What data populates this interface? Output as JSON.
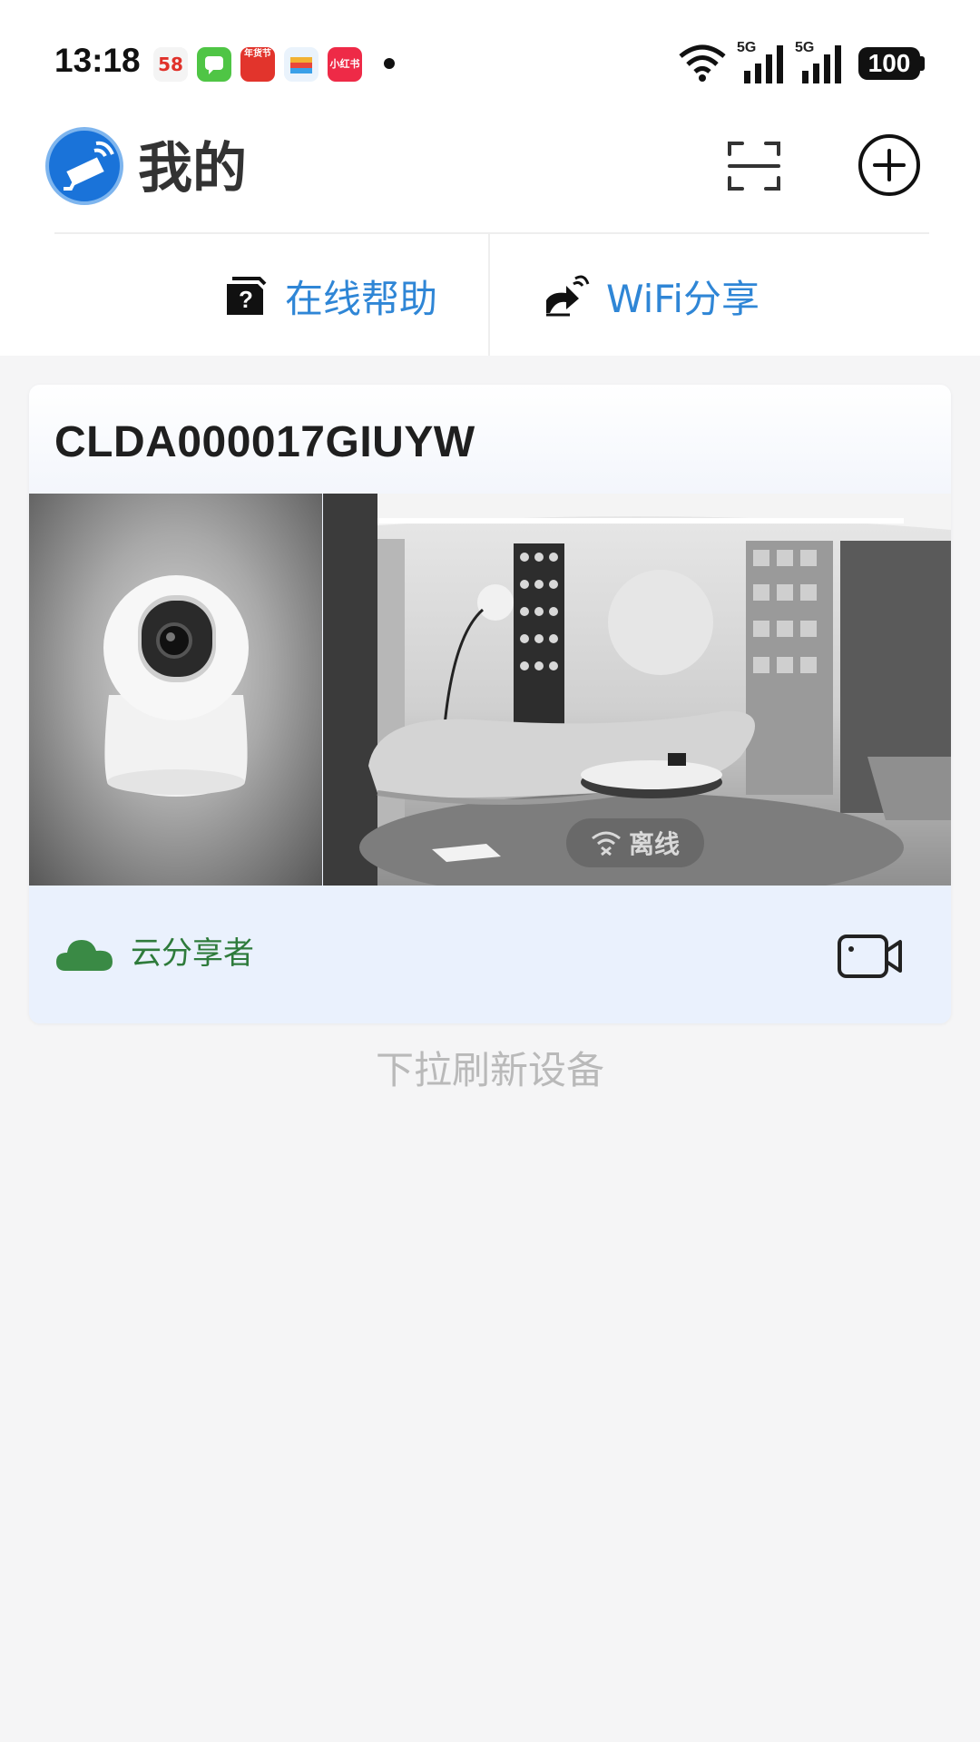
{
  "status_bar": {
    "time": "13:18",
    "notification_apps": [
      {
        "name": "58-app-icon",
        "text": "58",
        "color": "#f4f4f4"
      },
      {
        "name": "messages-icon",
        "text": "",
        "color": "#4fc545"
      },
      {
        "name": "new-year-app-icon",
        "text": "年货节",
        "color": "#e2342c"
      },
      {
        "name": "wallet-icon",
        "text": "",
        "color": "#eaf3fc"
      },
      {
        "name": "xiaohongshu-icon",
        "text": "小红书",
        "color": "#ee2a47"
      }
    ],
    "signal_1": "5G",
    "signal_2": "5G",
    "battery": "100"
  },
  "header": {
    "title": "我的",
    "logo_icon": "security-camera-logo-icon",
    "scan_icon": "scan-icon",
    "add_icon": "add-circle-icon"
  },
  "quick_actions": {
    "help_label": "在线帮助",
    "wifi_share_label": "WiFi分享"
  },
  "device": {
    "name": "CLDA000017GIUYW",
    "status": "离线",
    "share_label": "云分享者"
  },
  "footer": {
    "pull_hint": "下拉刷新设备"
  },
  "colors": {
    "accent_blue": "#2f86d6",
    "share_green": "#2e7b3b",
    "card_bg": "#eaf1fd"
  }
}
